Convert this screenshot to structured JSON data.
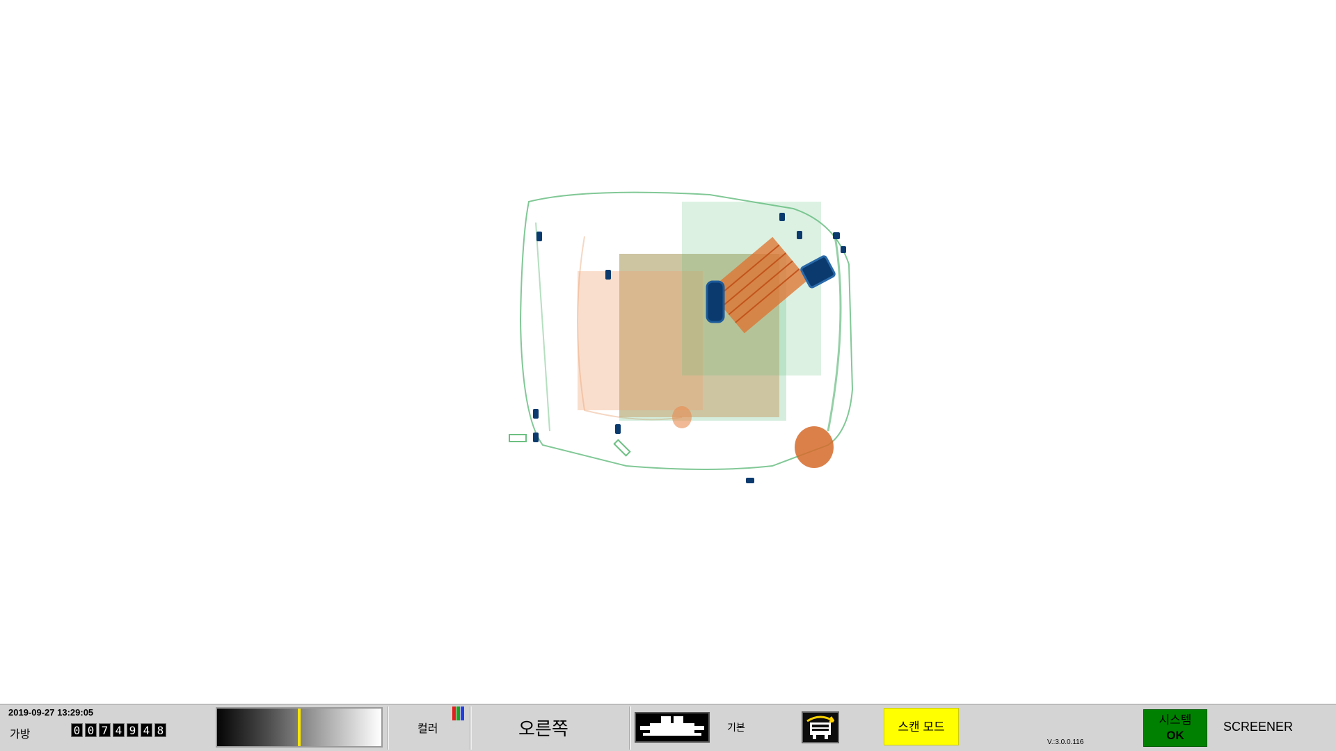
{
  "scan": {
    "image_description": "x-ray scan of bag",
    "colors": {
      "organic": "#e07a3c",
      "inorganic": "#3aa85a",
      "metal": "#0a3a6e"
    }
  },
  "statusbar": {
    "datetime": "2019-09-27 13:29:05",
    "bag_label": "가방",
    "bag_counter": [
      "0",
      "0",
      "7",
      "4",
      "9",
      "4",
      "8"
    ],
    "density_level": 0.5,
    "color_label": "컬러",
    "color_icon": [
      "#e02020",
      "#20a020",
      "#2040e0"
    ],
    "direction_label": "오른쪽",
    "basic_label": "기본",
    "scan_mode_label": "스캔 모드",
    "version": "V.:3.0.0.116",
    "system_status": {
      "line1": "시스템",
      "line2": "OK",
      "color": "#008000"
    },
    "user_role": "SCREENER"
  }
}
